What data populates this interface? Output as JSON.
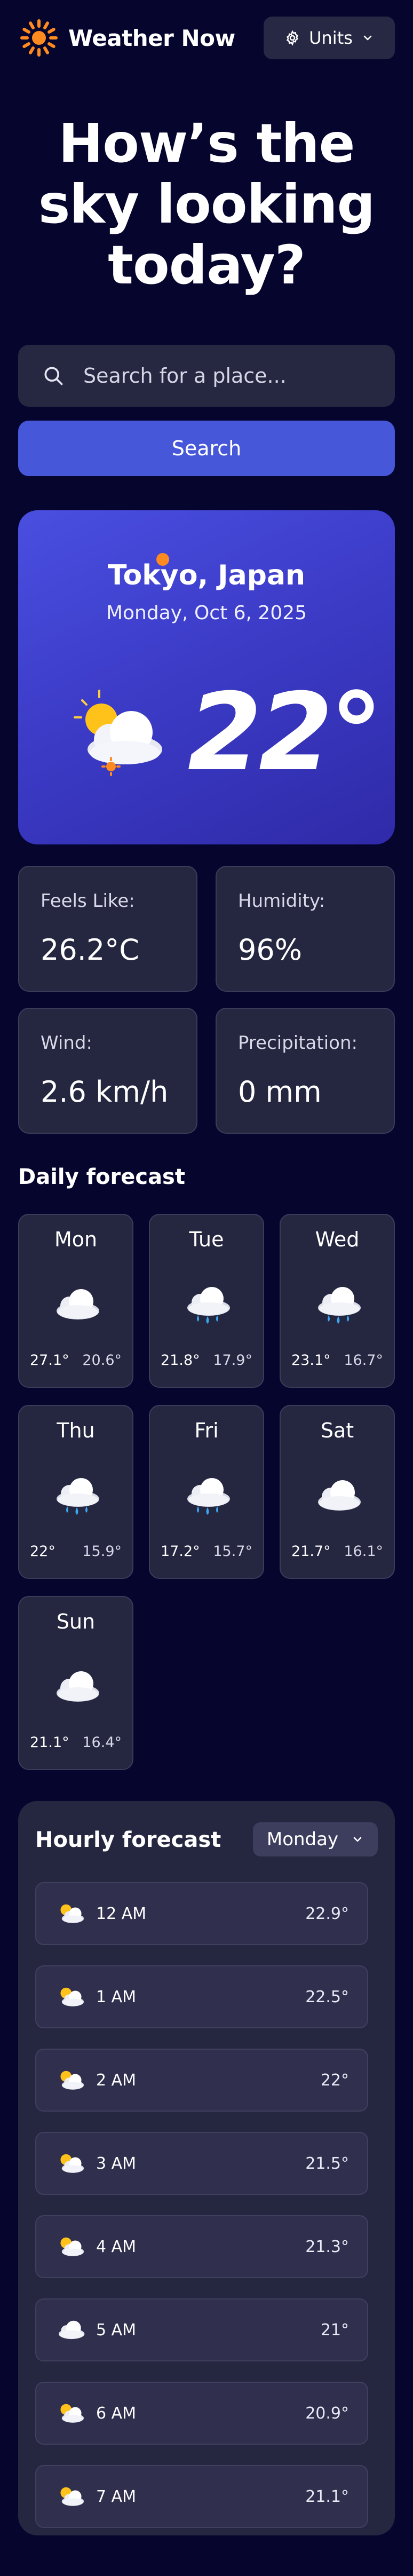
{
  "app": {
    "title": "Weather Now",
    "units_label": "Units"
  },
  "headline": "How’s the sky looking today?",
  "search": {
    "placeholder": "Search for a place...",
    "button_label": "Search"
  },
  "current": {
    "location": "Tokyo, Japan",
    "date": "Monday, Oct 6, 2025",
    "temperature": "22°"
  },
  "stats": [
    {
      "label": "Feels Like:",
      "value": "26.2°C"
    },
    {
      "label": "Humidity:",
      "value": "96%"
    },
    {
      "label": "Wind:",
      "value": "2.6 km/h"
    },
    {
      "label": "Precipitation:",
      "value": "0 mm"
    }
  ],
  "daily": {
    "title": "Daily forecast",
    "days": [
      {
        "name": "Mon",
        "icon": "cloud-icon",
        "high": "27.1°",
        "low": "20.6°"
      },
      {
        "name": "Tue",
        "icon": "rain-cloud-icon",
        "high": "21.8°",
        "low": "17.9°"
      },
      {
        "name": "Wed",
        "icon": "rain-cloud-icon",
        "high": "23.1°",
        "low": "16.7°"
      },
      {
        "name": "Thu",
        "icon": "rain-cloud-icon",
        "high": "22°",
        "low": "15.9°"
      },
      {
        "name": "Fri",
        "icon": "rain-cloud-icon",
        "high": "17.2°",
        "low": "15.7°"
      },
      {
        "name": "Sat",
        "icon": "cloud-icon",
        "high": "21.7°",
        "low": "16.1°"
      },
      {
        "name": "Sun",
        "icon": "cloud-icon",
        "high": "21.1°",
        "low": "16.4°"
      }
    ]
  },
  "hourly": {
    "title": "Hourly forecast",
    "selected_day": "Monday",
    "hours": [
      {
        "time": "12 AM",
        "temp": "22.9°",
        "icon": "partly-cloudy-icon"
      },
      {
        "time": "1 AM",
        "temp": "22.5°",
        "icon": "partly-cloudy-icon"
      },
      {
        "time": "2 AM",
        "temp": "22°",
        "icon": "partly-cloudy-icon"
      },
      {
        "time": "3 AM",
        "temp": "21.5°",
        "icon": "partly-cloudy-icon"
      },
      {
        "time": "4 AM",
        "temp": "21.3°",
        "icon": "partly-cloudy-icon"
      },
      {
        "time": "5 AM",
        "temp": "21°",
        "icon": "cloud-icon"
      },
      {
        "time": "6 AM",
        "temp": "20.9°",
        "icon": "partly-cloudy-icon"
      },
      {
        "time": "7 AM",
        "temp": "21.1°",
        "icon": "partly-cloudy-icon"
      }
    ]
  },
  "colors": {
    "background": "#05052e",
    "accent": "#4658d9",
    "card": "#25263f",
    "sun": "#ff8a1f"
  }
}
